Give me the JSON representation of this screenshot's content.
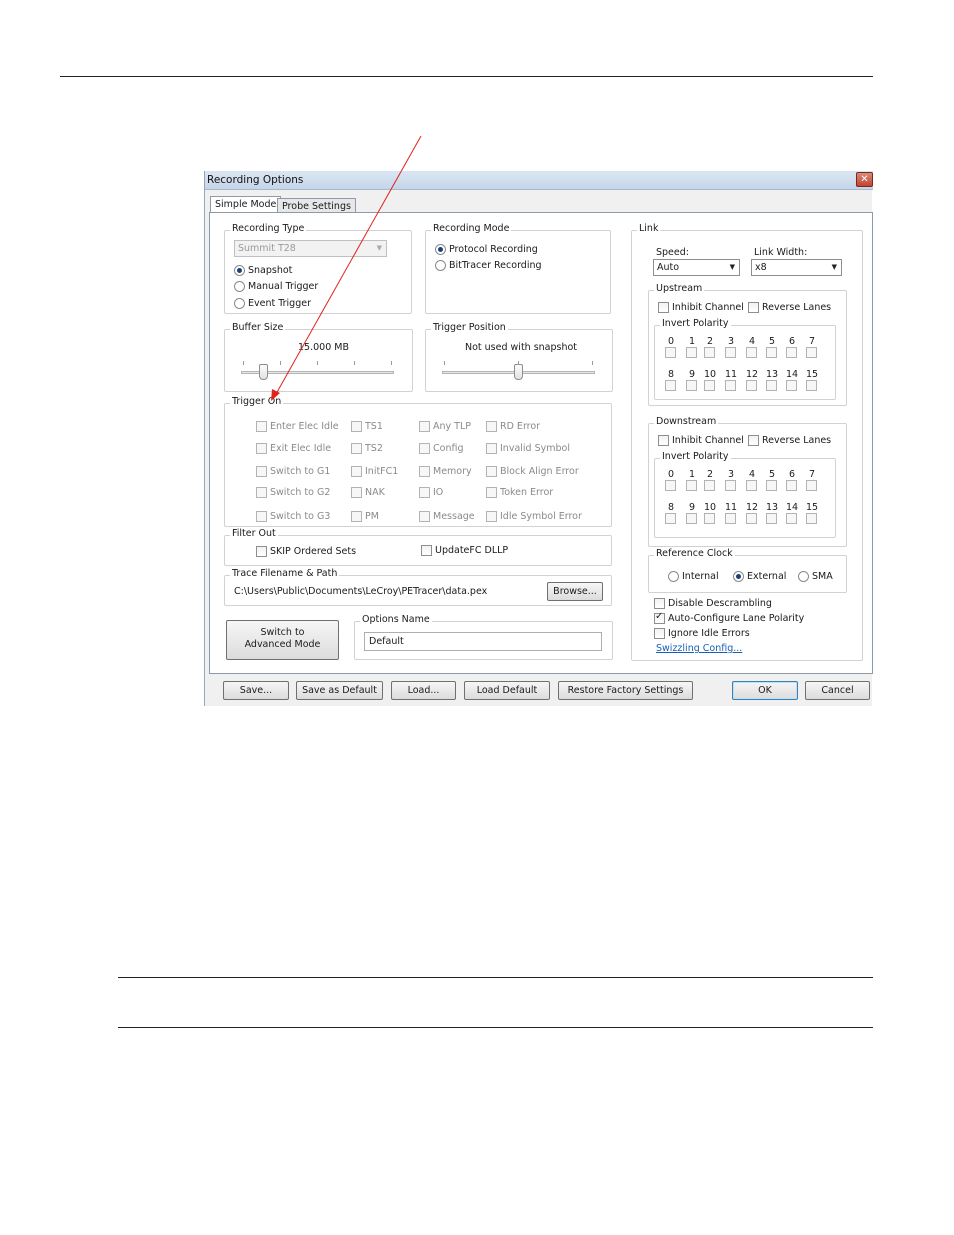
{
  "dialog": {
    "title": "Recording Options",
    "close_glyph": "✕",
    "tabs": [
      {
        "label": "Simple Mode"
      },
      {
        "label": "Probe Settings"
      }
    ]
  },
  "recording_type": {
    "legend": "Recording Type",
    "analyzer": "Summit T28",
    "options": [
      {
        "label": "Snapshot",
        "selected": true
      },
      {
        "label": "Manual Trigger",
        "selected": false
      },
      {
        "label": "Event Trigger",
        "selected": false
      }
    ]
  },
  "recording_mode": {
    "legend": "Recording Mode",
    "options": [
      {
        "label": "Protocol Recording",
        "selected": true
      },
      {
        "label": "BitTracer Recording",
        "selected": false
      }
    ]
  },
  "buffer_size": {
    "legend": "Buffer Size",
    "value": "15.000 MB"
  },
  "trigger_position": {
    "legend": "Trigger Position",
    "note": "Not used with snapshot"
  },
  "trigger_on": {
    "legend": "Trigger On",
    "columns": [
      [
        "Enter Elec Idle",
        "Exit Elec Idle",
        "Switch to G1",
        "Switch to G2",
        "Switch to G3"
      ],
      [
        "TS1",
        "TS2",
        "InitFC1",
        "NAK",
        "PM"
      ],
      [
        "Any TLP",
        "Config",
        "Memory",
        "IO",
        "Message"
      ],
      [
        "RD Error",
        "Invalid Symbol",
        "Block Align Error",
        "Token Error",
        "Idle Symbol Error"
      ]
    ]
  },
  "filter_out": {
    "legend": "Filter Out",
    "items": [
      {
        "label": "SKIP Ordered Sets"
      },
      {
        "label": "UpdateFC DLLP"
      }
    ]
  },
  "trace_file": {
    "legend": "Trace Filename & Path",
    "path": "C:\\Users\\Public\\Documents\\LeCroy\\PETracer\\data.pex",
    "browse_label": "Browse..."
  },
  "switch_mode": {
    "line1": "Switch to",
    "line2": "Advanced Mode"
  },
  "options_name": {
    "legend": "Options Name",
    "value": "Default"
  },
  "link": {
    "legend": "Link",
    "speed_label": "Speed:",
    "speed_value": "Auto",
    "width_label": "Link Width:",
    "width_value": "x8",
    "upstream": {
      "legend": "Upstream",
      "inhibit": "Inhibit Channel",
      "reverse": "Reverse Lanes",
      "invert": "Invert Polarity"
    },
    "downstream": {
      "legend": "Downstream",
      "inhibit": "Inhibit Channel",
      "reverse": "Reverse Lanes",
      "invert": "Invert Polarity"
    },
    "lanes_row1": [
      "0",
      "1",
      "2",
      "3",
      "4",
      "5",
      "6",
      "7"
    ],
    "lanes_row2": [
      "8",
      "9",
      "10",
      "11",
      "12",
      "13",
      "14",
      "15"
    ]
  },
  "reference_clock": {
    "legend": "Reference Clock",
    "options": [
      {
        "label": "Internal",
        "selected": false
      },
      {
        "label": "External",
        "selected": true
      },
      {
        "label": "SMA",
        "selected": false
      }
    ]
  },
  "misc_options": [
    {
      "label": "Disable Descrambling",
      "checked": false
    },
    {
      "label": "Auto-Configure Lane Polarity",
      "checked": true
    },
    {
      "label": "Ignore Idle Errors",
      "checked": false
    }
  ],
  "swizzling_link": "Swizzling Config...",
  "buttons": {
    "save": "Save...",
    "save_default": "Save as Default",
    "load": "Load...",
    "load_default": "Load Default",
    "restore": "Restore Factory Settings",
    "ok": "OK",
    "cancel": "Cancel"
  },
  "colors": {
    "annotation_arrow": "#e0241b",
    "title_bar": "#c5d5e8",
    "accent": "#3c7fb1"
  }
}
